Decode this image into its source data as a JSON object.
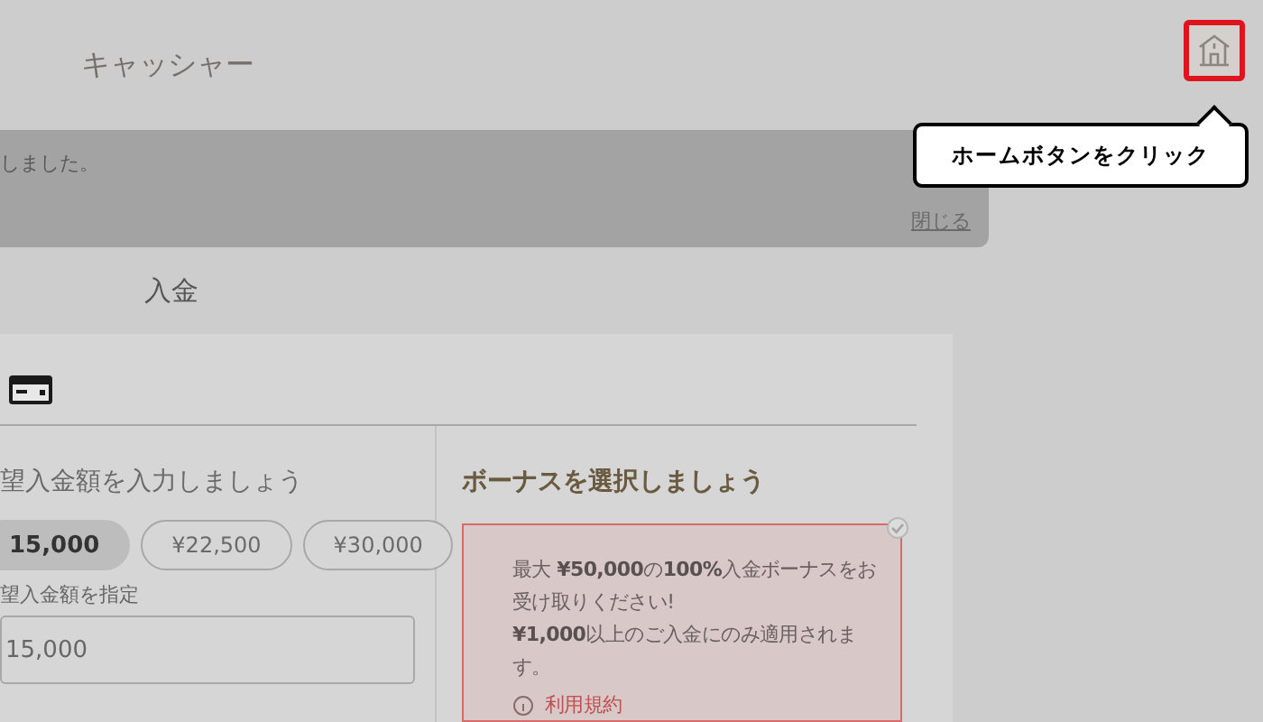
{
  "header": {
    "title": "キャッシャー"
  },
  "notice": {
    "text": "しました。",
    "close_link": "閉じる"
  },
  "section_tab": {
    "label": "入金"
  },
  "deposit": {
    "amount_heading": "望入金額を入力しましょう",
    "presets": [
      {
        "label": "15,000",
        "selected": true
      },
      {
        "label": "¥22,500",
        "selected": false
      },
      {
        "label": "¥30,000",
        "selected": false
      }
    ],
    "custom_label": "望入金額を指定",
    "amount_field": {
      "value": "15,000"
    }
  },
  "bonus": {
    "heading": "ボーナスを選択しましょう",
    "offers": [
      {
        "text": "最大 **¥50,000**の**100%**入金ボーナスをお受け取りください!\n**¥1,000**以上のご入金にのみ適用されます。",
        "terms_link": "利用規約",
        "selected": true
      }
    ]
  },
  "tooltip": {
    "text": "ホームボタンをクリック"
  }
}
